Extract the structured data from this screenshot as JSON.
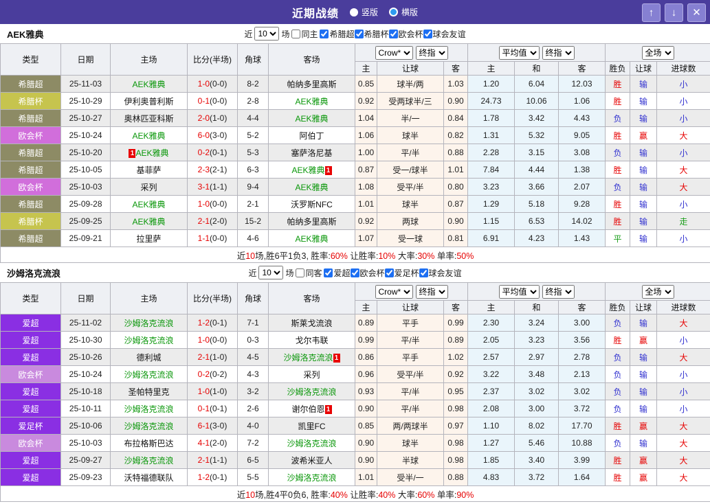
{
  "title_bar": {
    "title": "近期战绩",
    "radio_vertical": "竖版",
    "radio_horizontal": "横版",
    "up_icon": "↑",
    "down_icon": "↓",
    "close_icon": "✕"
  },
  "colors": {
    "titlebar_bg": "#4a3d9c",
    "greek_super": "#8d8b65",
    "greek_cup": "#c6c44e",
    "conf_league": "#d16edb",
    "irish_premier": "#8a2fe3",
    "focus_team_green": "#089608",
    "score_red": "#e60000",
    "win_red": "#e60000",
    "lose_blue": "#3030cf",
    "draw_green": "#1a9e1a"
  },
  "table_header": {
    "type": "类型",
    "date": "日期",
    "home": "主场",
    "score": "比分(半场)",
    "corner": "角球",
    "away": "客场",
    "bookmaker_select": "Crow*",
    "final_select_1": "终指",
    "average_select": "平均值",
    "final_select_2": "终指",
    "fulltime_select": "全场",
    "h": "主",
    "handicap": "让球",
    "a": "客",
    "avg_h": "主",
    "avg_d": "和",
    "avg_a": "客",
    "wl": "胜负",
    "cover": "让球",
    "goals": "进球数"
  },
  "sections": [
    {
      "team": "AEK雅典",
      "filter": {
        "near": "近",
        "count": "10",
        "games": "场",
        "same_label": "同主",
        "leagues": [
          "希腊超",
          "希腊杯",
          "欧会杯",
          "球会友谊"
        ]
      },
      "rows": [
        {
          "league": "希腊超",
          "league_key": "greek-super",
          "date": "25-11-03",
          "home": "AEK雅典",
          "home_f": "1",
          "home_red": "",
          "ft": "1-0",
          "ht": "(0-0)",
          "corner": "8-2",
          "away": "帕纳多里高斯",
          "away_f": "0",
          "away_red": "",
          "o_h": "0.85",
          "hcp": "球半/两",
          "o_a": "1.03",
          "avg_h": "1.20",
          "avg_d": "6.04",
          "avg_a": "12.03",
          "wl": "胜",
          "wl_c": "r",
          "cv": "输",
          "cv_c": "b",
          "ou": "小",
          "ou_c": "b"
        },
        {
          "league": "希腊杯",
          "league_key": "greek-cup",
          "date": "25-10-29",
          "home": "伊利奥普利斯",
          "home_f": "0",
          "home_red": "",
          "ft": "0-1",
          "ht": "(0-0)",
          "corner": "2-8",
          "away": "AEK雅典",
          "away_f": "1",
          "away_red": "",
          "o_h": "0.92",
          "hcp": "受两球半/三",
          "o_a": "0.90",
          "avg_h": "24.73",
          "avg_d": "10.06",
          "avg_a": "1.06",
          "wl": "胜",
          "wl_c": "r",
          "cv": "输",
          "cv_c": "b",
          "ou": "小",
          "ou_c": "b"
        },
        {
          "league": "希腊超",
          "league_key": "greek-super",
          "date": "25-10-27",
          "home": "奥林匹亚科斯",
          "home_f": "0",
          "home_red": "",
          "ft": "2-0",
          "ht": "(1-0)",
          "corner": "4-4",
          "away": "AEK雅典",
          "away_f": "1",
          "away_red": "",
          "o_h": "1.04",
          "hcp": "半/一",
          "o_a": "0.84",
          "avg_h": "1.78",
          "avg_d": "3.42",
          "avg_a": "4.43",
          "wl": "负",
          "wl_c": "b",
          "cv": "输",
          "cv_c": "b",
          "ou": "小",
          "ou_c": "b"
        },
        {
          "league": "欧会杯",
          "league_key": "conf-league",
          "date": "25-10-24",
          "home": "AEK雅典",
          "home_f": "1",
          "home_red": "",
          "ft": "6-0",
          "ht": "(3-0)",
          "corner": "5-2",
          "away": "阿伯丁",
          "away_f": "0",
          "away_red": "",
          "o_h": "1.06",
          "hcp": "球半",
          "o_a": "0.82",
          "avg_h": "1.31",
          "avg_d": "5.32",
          "avg_a": "9.05",
          "wl": "胜",
          "wl_c": "r",
          "cv": "赢",
          "cv_c": "r",
          "ou": "大",
          "ou_c": "r"
        },
        {
          "league": "希腊超",
          "league_key": "greek-super",
          "date": "25-10-20",
          "home": "AEK雅典",
          "home_f": "1",
          "home_red": "1",
          "ft": "0-2",
          "ht": "(0-1)",
          "corner": "5-3",
          "away": "塞萨洛尼基",
          "away_f": "0",
          "away_red": "",
          "o_h": "1.00",
          "hcp": "平/半",
          "o_a": "0.88",
          "avg_h": "2.28",
          "avg_d": "3.15",
          "avg_a": "3.08",
          "wl": "负",
          "wl_c": "b",
          "cv": "输",
          "cv_c": "b",
          "ou": "小",
          "ou_c": "b"
        },
        {
          "league": "希腊超",
          "league_key": "greek-super",
          "date": "25-10-05",
          "home": "基菲萨",
          "home_f": "0",
          "home_red": "",
          "ft": "2-3",
          "ht": "(2-1)",
          "corner": "6-3",
          "away": "AEK雅典",
          "away_f": "1",
          "away_red": "1",
          "o_h": "0.87",
          "hcp": "受一/球半",
          "o_a": "1.01",
          "avg_h": "7.84",
          "avg_d": "4.44",
          "avg_a": "1.38",
          "wl": "胜",
          "wl_c": "r",
          "cv": "输",
          "cv_c": "b",
          "ou": "大",
          "ou_c": "r"
        },
        {
          "league": "欧会杯",
          "league_key": "conf-league",
          "date": "25-10-03",
          "home": "采列",
          "home_f": "0",
          "home_red": "",
          "ft": "3-1",
          "ht": "(1-1)",
          "corner": "9-4",
          "away": "AEK雅典",
          "away_f": "1",
          "away_red": "",
          "o_h": "1.08",
          "hcp": "受平/半",
          "o_a": "0.80",
          "avg_h": "3.23",
          "avg_d": "3.66",
          "avg_a": "2.07",
          "wl": "负",
          "wl_c": "b",
          "cv": "输",
          "cv_c": "b",
          "ou": "大",
          "ou_c": "r"
        },
        {
          "league": "希腊超",
          "league_key": "greek-super",
          "date": "25-09-28",
          "home": "AEK雅典",
          "home_f": "1",
          "home_red": "",
          "ft": "1-0",
          "ht": "(0-0)",
          "corner": "2-1",
          "away": "沃罗斯NFC",
          "away_f": "0",
          "away_red": "",
          "o_h": "1.01",
          "hcp": "球半",
          "o_a": "0.87",
          "avg_h": "1.29",
          "avg_d": "5.18",
          "avg_a": "9.28",
          "wl": "胜",
          "wl_c": "r",
          "cv": "输",
          "cv_c": "b",
          "ou": "小",
          "ou_c": "b"
        },
        {
          "league": "希腊杯",
          "league_key": "greek-cup",
          "date": "25-09-25",
          "home": "AEK雅典",
          "home_f": "1",
          "home_red": "",
          "ft": "2-1",
          "ht": "(2-0)",
          "corner": "15-2",
          "away": "帕纳多里高斯",
          "away_f": "0",
          "away_red": "",
          "o_h": "0.92",
          "hcp": "两球",
          "o_a": "0.90",
          "avg_h": "1.15",
          "avg_d": "6.53",
          "avg_a": "14.02",
          "wl": "胜",
          "wl_c": "r",
          "cv": "输",
          "cv_c": "b",
          "ou": "走",
          "ou_c": "g"
        },
        {
          "league": "希腊超",
          "league_key": "greek-super",
          "date": "25-09-21",
          "home": "拉里萨",
          "home_f": "0",
          "home_red": "",
          "ft": "1-1",
          "ht": "(0-0)",
          "corner": "4-6",
          "away": "AEK雅典",
          "away_f": "1",
          "away_red": "",
          "o_h": "1.07",
          "hcp": "受一球",
          "o_a": "0.81",
          "avg_h": "6.91",
          "avg_d": "4.23",
          "avg_a": "1.43",
          "wl": "平",
          "wl_c": "g",
          "cv": "输",
          "cv_c": "b",
          "ou": "小",
          "ou_c": "b"
        }
      ],
      "summary": [
        {
          "t": "近",
          "c": "k"
        },
        {
          "t": "10",
          "c": "r"
        },
        {
          "t": "场,胜6平1负3, 胜率:",
          "c": "k"
        },
        {
          "t": "60%",
          "c": "r"
        },
        {
          "t": " 让胜率:",
          "c": "k"
        },
        {
          "t": "10%",
          "c": "r"
        },
        {
          "t": " 大率:",
          "c": "k"
        },
        {
          "t": "30%",
          "c": "r"
        },
        {
          "t": " 单率:",
          "c": "k"
        },
        {
          "t": "50%",
          "c": "r"
        }
      ]
    },
    {
      "team": "沙姆洛克流浪",
      "filter": {
        "near": "近",
        "count": "10",
        "games": "场",
        "same_label": "同客",
        "leagues": [
          "爱超",
          "欧会杯",
          "爱足杯",
          "球会友谊"
        ]
      },
      "rows": [
        {
          "league": "爱超",
          "league_key": "irish-premier",
          "date": "25-11-02",
          "home": "沙姆洛克流浪",
          "home_f": "1",
          "home_red": "",
          "ft": "1-2",
          "ht": "(0-1)",
          "corner": "7-1",
          "away": "斯莱戈流浪",
          "away_f": "0",
          "away_red": "",
          "o_h": "0.89",
          "hcp": "平手",
          "o_a": "0.99",
          "avg_h": "2.30",
          "avg_d": "3.24",
          "avg_a": "3.00",
          "wl": "负",
          "wl_c": "b",
          "cv": "输",
          "cv_c": "b",
          "ou": "大",
          "ou_c": "r"
        },
        {
          "league": "爱超",
          "league_key": "irish-premier",
          "date": "25-10-30",
          "home": "沙姆洛克流浪",
          "home_f": "1",
          "home_red": "",
          "ft": "1-0",
          "ht": "(0-0)",
          "corner": "0-3",
          "away": "戈尔韦联",
          "away_f": "0",
          "away_red": "",
          "o_h": "0.99",
          "hcp": "平/半",
          "o_a": "0.89",
          "avg_h": "2.05",
          "avg_d": "3.23",
          "avg_a": "3.56",
          "wl": "胜",
          "wl_c": "r",
          "cv": "赢",
          "cv_c": "r",
          "ou": "小",
          "ou_c": "b"
        },
        {
          "league": "爱超",
          "league_key": "irish-premier",
          "date": "25-10-26",
          "home": "德利城",
          "home_f": "0",
          "home_red": "",
          "ft": "2-1",
          "ht": "(1-0)",
          "corner": "4-5",
          "away": "沙姆洛克流浪",
          "away_f": "1",
          "away_red": "1",
          "o_h": "0.86",
          "hcp": "平手",
          "o_a": "1.02",
          "avg_h": "2.57",
          "avg_d": "2.97",
          "avg_a": "2.78",
          "wl": "负",
          "wl_c": "b",
          "cv": "输",
          "cv_c": "b",
          "ou": "大",
          "ou_c": "r"
        },
        {
          "league": "欧会杯",
          "league_key": "conf-league",
          "date": "25-10-24",
          "home": "沙姆洛克流浪",
          "home_f": "1",
          "home_red": "",
          "ft": "0-2",
          "ht": "(0-2)",
          "corner": "4-3",
          "away": "采列",
          "away_f": "0",
          "away_red": "",
          "o_h": "0.96",
          "hcp": "受平/半",
          "o_a": "0.92",
          "avg_h": "3.22",
          "avg_d": "3.48",
          "avg_a": "2.13",
          "wl": "负",
          "wl_c": "b",
          "cv": "输",
          "cv_c": "b",
          "ou": "小",
          "ou_c": "b"
        },
        {
          "league": "爱超",
          "league_key": "irish-premier",
          "date": "25-10-18",
          "home": "圣帕特里克",
          "home_f": "0",
          "home_red": "",
          "ft": "1-0",
          "ht": "(1-0)",
          "corner": "3-2",
          "away": "沙姆洛克流浪",
          "away_f": "1",
          "away_red": "",
          "o_h": "0.93",
          "hcp": "平/半",
          "o_a": "0.95",
          "avg_h": "2.37",
          "avg_d": "3.02",
          "avg_a": "3.02",
          "wl": "负",
          "wl_c": "b",
          "cv": "输",
          "cv_c": "b",
          "ou": "小",
          "ou_c": "b"
        },
        {
          "league": "爱超",
          "league_key": "irish-premier",
          "date": "25-10-11",
          "home": "沙姆洛克流浪",
          "home_f": "1",
          "home_red": "",
          "ft": "0-1",
          "ht": "(0-1)",
          "corner": "2-6",
          "away": "谢尔伯恩",
          "away_f": "0",
          "away_red": "1",
          "o_h": "0.90",
          "hcp": "平/半",
          "o_a": "0.98",
          "avg_h": "2.08",
          "avg_d": "3.00",
          "avg_a": "3.72",
          "wl": "负",
          "wl_c": "b",
          "cv": "输",
          "cv_c": "b",
          "ou": "小",
          "ou_c": "b"
        },
        {
          "league": "爱足杯",
          "league_key": "irish-cup",
          "date": "25-10-06",
          "home": "沙姆洛克流浪",
          "home_f": "1",
          "home_red": "",
          "ft": "6-1",
          "ht": "(3-0)",
          "corner": "4-0",
          "away": "凯里FC",
          "away_f": "0",
          "away_red": "",
          "o_h": "0.85",
          "hcp": "两/两球半",
          "o_a": "0.97",
          "avg_h": "1.10",
          "avg_d": "8.02",
          "avg_a": "17.70",
          "wl": "胜",
          "wl_c": "r",
          "cv": "赢",
          "cv_c": "r",
          "ou": "大",
          "ou_c": "r"
        },
        {
          "league": "欧会杯",
          "league_key": "conf-league",
          "date": "25-10-03",
          "home": "布拉格斯巴达",
          "home_f": "0",
          "home_red": "",
          "ft": "4-1",
          "ht": "(2-0)",
          "corner": "7-2",
          "away": "沙姆洛克流浪",
          "away_f": "1",
          "away_red": "",
          "o_h": "0.90",
          "hcp": "球半",
          "o_a": "0.98",
          "avg_h": "1.27",
          "avg_d": "5.46",
          "avg_a": "10.88",
          "wl": "负",
          "wl_c": "b",
          "cv": "输",
          "cv_c": "b",
          "ou": "大",
          "ou_c": "r"
        },
        {
          "league": "爱超",
          "league_key": "irish-premier",
          "date": "25-09-27",
          "home": "沙姆洛克流浪",
          "home_f": "1",
          "home_red": "",
          "ft": "2-1",
          "ht": "(1-1)",
          "corner": "6-5",
          "away": "波希米亚人",
          "away_f": "0",
          "away_red": "",
          "o_h": "0.90",
          "hcp": "半球",
          "o_a": "0.98",
          "avg_h": "1.85",
          "avg_d": "3.40",
          "avg_a": "3.99",
          "wl": "胜",
          "wl_c": "r",
          "cv": "赢",
          "cv_c": "r",
          "ou": "大",
          "ou_c": "r"
        },
        {
          "league": "爱超",
          "league_key": "irish-premier",
          "date": "25-09-23",
          "home": "沃特福德联队",
          "home_f": "0",
          "home_red": "",
          "ft": "1-2",
          "ht": "(0-1)",
          "corner": "5-5",
          "away": "沙姆洛克流浪",
          "away_f": "1",
          "away_red": "",
          "o_h": "1.01",
          "hcp": "受半/一",
          "o_a": "0.88",
          "avg_h": "4.83",
          "avg_d": "3.72",
          "avg_a": "1.64",
          "wl": "胜",
          "wl_c": "r",
          "cv": "赢",
          "cv_c": "r",
          "ou": "大",
          "ou_c": "r"
        }
      ],
      "summary": [
        {
          "t": "近",
          "c": "k"
        },
        {
          "t": "10",
          "c": "r"
        },
        {
          "t": "场,胜4平0负6, 胜率:",
          "c": "k"
        },
        {
          "t": "40%",
          "c": "r"
        },
        {
          "t": " 让胜率:",
          "c": "k"
        },
        {
          "t": "40%",
          "c": "r"
        },
        {
          "t": " 大率:",
          "c": "k"
        },
        {
          "t": "60%",
          "c": "r"
        },
        {
          "t": " 单率:",
          "c": "k"
        },
        {
          "t": "90%",
          "c": "r"
        }
      ]
    }
  ]
}
